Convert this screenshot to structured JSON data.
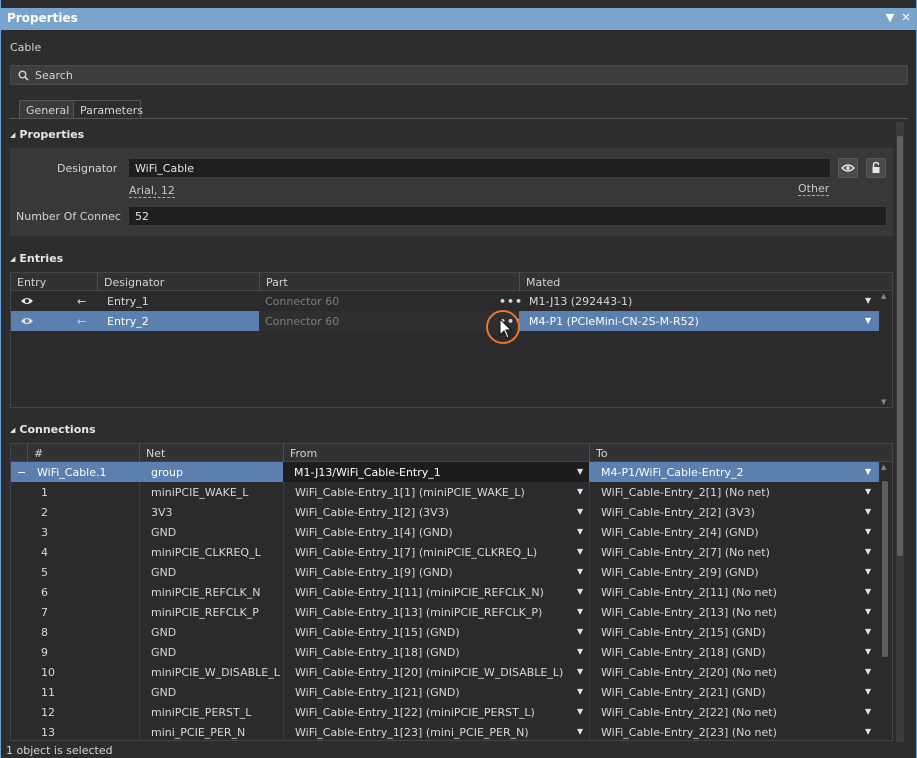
{
  "window": {
    "title": "Properties",
    "pin_icon": "dropdown-arrow-icon",
    "close_icon": "close-icon"
  },
  "object_kind": "Cable",
  "search": {
    "placeholder": "Search"
  },
  "tabs": [
    {
      "label": "General"
    },
    {
      "label": "Parameters"
    }
  ],
  "properties_section": {
    "title": "Properties",
    "designator_label": "Designator",
    "designator_value": "WiFi_Cable",
    "font_link": "Arial, 12",
    "other_link": "Other",
    "connections_label": "Number Of Connec",
    "connections_value": "52"
  },
  "entries_section": {
    "title": "Entries",
    "columns": [
      "Entry",
      "Designator",
      "Part",
      "Mated"
    ],
    "rows": [
      {
        "designator": "Entry_1",
        "part": "Connector 60",
        "mated": "M1-J13 (292443-1)"
      },
      {
        "designator": "Entry_2",
        "part": "Connector 60",
        "mated": "M4-P1 (PCIeMini-CN-2S-M-R52)"
      }
    ]
  },
  "connections_section": {
    "title": "Connections",
    "columns": [
      "#",
      "Net",
      "From",
      "To"
    ],
    "group_row": {
      "toggle": "−",
      "num": "WiFi_Cable.1",
      "net": "group",
      "from": "M1-J13/WiFi_Cable-Entry_1",
      "to": "M4-P1/WiFi_Cable-Entry_2"
    },
    "rows": [
      {
        "num": "1",
        "net": "miniPCIE_WAKE_L",
        "from": "WiFi_Cable-Entry_1[1] (miniPCIE_WAKE_L)",
        "to": "WiFi_Cable-Entry_2[1] (No net)"
      },
      {
        "num": "2",
        "net": "3V3",
        "from": "WiFi_Cable-Entry_1[2] (3V3)",
        "to": "WiFi_Cable-Entry_2[2] (3V3)"
      },
      {
        "num": "3",
        "net": "GND",
        "from": "WiFi_Cable-Entry_1[4] (GND)",
        "to": "WiFi_Cable-Entry_2[4] (GND)"
      },
      {
        "num": "4",
        "net": "miniPCIE_CLKREQ_L",
        "from": "WiFi_Cable-Entry_1[7] (miniPCIE_CLKREQ_L)",
        "to": "WiFi_Cable-Entry_2[7] (No net)"
      },
      {
        "num": "5",
        "net": "GND",
        "from": "WiFi_Cable-Entry_1[9] (GND)",
        "to": "WiFi_Cable-Entry_2[9] (GND)"
      },
      {
        "num": "6",
        "net": "miniPCIE_REFCLK_N",
        "from": "WiFi_Cable-Entry_1[11] (miniPCIE_REFCLK_N)",
        "to": "WiFi_Cable-Entry_2[11] (No net)"
      },
      {
        "num": "7",
        "net": "miniPCIE_REFCLK_P",
        "from": "WiFi_Cable-Entry_1[13] (miniPCIE_REFCLK_P)",
        "to": "WiFi_Cable-Entry_2[13] (No net)"
      },
      {
        "num": "8",
        "net": "GND",
        "from": "WiFi_Cable-Entry_1[15] (GND)",
        "to": "WiFi_Cable-Entry_2[15] (GND)"
      },
      {
        "num": "9",
        "net": "GND",
        "from": "WiFi_Cable-Entry_1[18] (GND)",
        "to": "WiFi_Cable-Entry_2[18] (GND)"
      },
      {
        "num": "10",
        "net": "miniPCIE_W_DISABLE_L",
        "from": "WiFi_Cable-Entry_1[20] (miniPCIE_W_DISABLE_L)",
        "to": "WiFi_Cable-Entry_2[20] (No net)"
      },
      {
        "num": "11",
        "net": "GND",
        "from": "WiFi_Cable-Entry_1[21] (GND)",
        "to": "WiFi_Cable-Entry_2[21] (GND)"
      },
      {
        "num": "12",
        "net": "miniPCIE_PERST_L",
        "from": "WiFi_Cable-Entry_1[22] (miniPCIE_PERST_L)",
        "to": "WiFi_Cable-Entry_2[22] (No net)"
      },
      {
        "num": "13",
        "net": "mini_PCIE_PER_N",
        "from": "WiFi_Cable-Entry_1[23] (mini_PCIE_PER_N)",
        "to": "WiFi_Cable-Entry_2[23] (No net)"
      }
    ]
  },
  "status": "1 object is selected",
  "colors": {
    "title_bar": "#7ba4cc",
    "selection": "#5b7fae",
    "highlight_ring": "#e8772e",
    "panel_bg": "#2d2d2f"
  }
}
